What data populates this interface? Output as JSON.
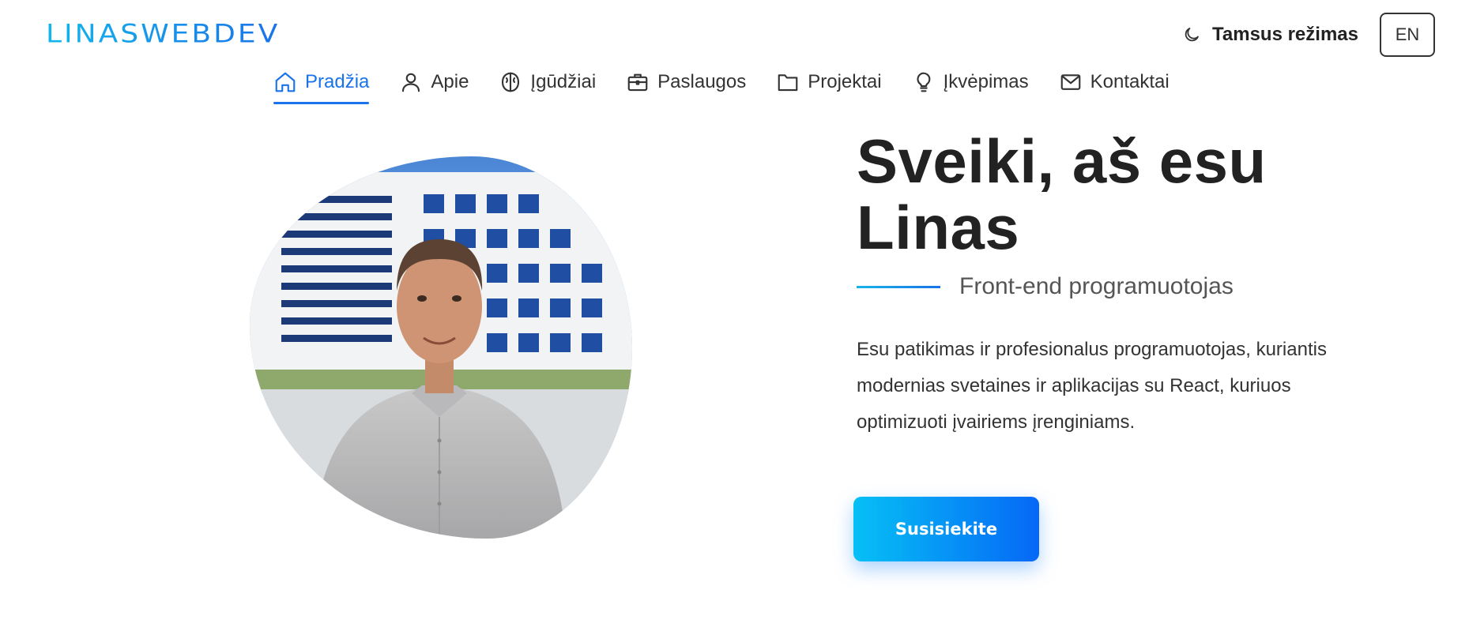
{
  "brand": {
    "logo": "LINASWEBDEV"
  },
  "header": {
    "theme_toggle_label": "Tamsus režimas",
    "theme_icon": "moon-icon",
    "language_button": "EN"
  },
  "nav": {
    "items": [
      {
        "label": "Pradžia",
        "icon": "home-icon",
        "active": true
      },
      {
        "label": "Apie",
        "icon": "user-icon",
        "active": false
      },
      {
        "label": "Įgūdžiai",
        "icon": "brain-icon",
        "active": false
      },
      {
        "label": "Paslaugos",
        "icon": "briefcase-icon",
        "active": false
      },
      {
        "label": "Projektai",
        "icon": "folder-icon",
        "active": false
      },
      {
        "label": "Įkvėpimas",
        "icon": "lightbulb-icon",
        "active": false
      },
      {
        "label": "Kontaktai",
        "icon": "mail-icon",
        "active": false
      }
    ],
    "active_color": "#1a73e8"
  },
  "hero": {
    "title_line1": "Sveiki, aš esu",
    "title_line2": "Linas",
    "subtitle": "Front-end programuotojas",
    "description": "Esu patikimas ir profesionalus programuotojas, kuriantis modernias svetaines ir aplikacijas su React, kuriuos optimizuoti įvairiems įrenginiams.",
    "cta_label": "Susisiekite",
    "photo_alt": "profile-photo"
  },
  "colors": {
    "accent": "#1a73e8",
    "accent_light": "#06c0f5",
    "text": "#222222"
  }
}
